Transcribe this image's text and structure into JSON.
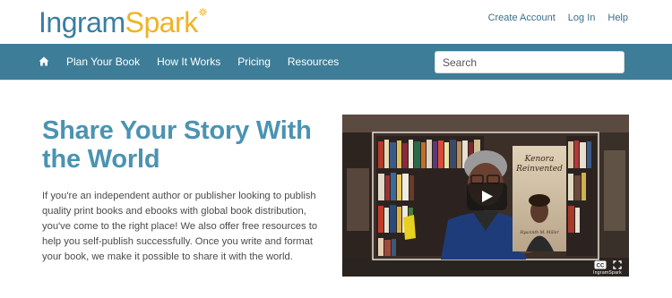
{
  "header": {
    "logo": {
      "part1": "Ingram",
      "part2": "Spark"
    },
    "links": [
      "Create Account",
      "Log In",
      "Help"
    ]
  },
  "nav": {
    "home_icon": "home-icon",
    "items": [
      "Plan Your Book",
      "How It Works",
      "Pricing",
      "Resources"
    ],
    "search_placeholder": "Search"
  },
  "hero": {
    "title": "Share Your Story With the World",
    "body": "If you're an independent author or publisher looking to publish quality print books and ebooks with global book distribution, you've come to the right place! We also offer free resources to help you self-publish successfully. Once you write and format your book, we make it possible to share it with the world."
  },
  "video": {
    "book_title": "Kenora Reinvented",
    "book_author": "Hyacinth M. Miller",
    "brand": "IngramSpark",
    "icons": [
      "play-icon",
      "closed-captions-icon",
      "fullscreen-icon"
    ]
  },
  "colors": {
    "nav_bg": "#3d7d98",
    "title": "#4b93b2",
    "logo_blue": "#3a7ea1",
    "logo_gold": "#f0b323"
  }
}
